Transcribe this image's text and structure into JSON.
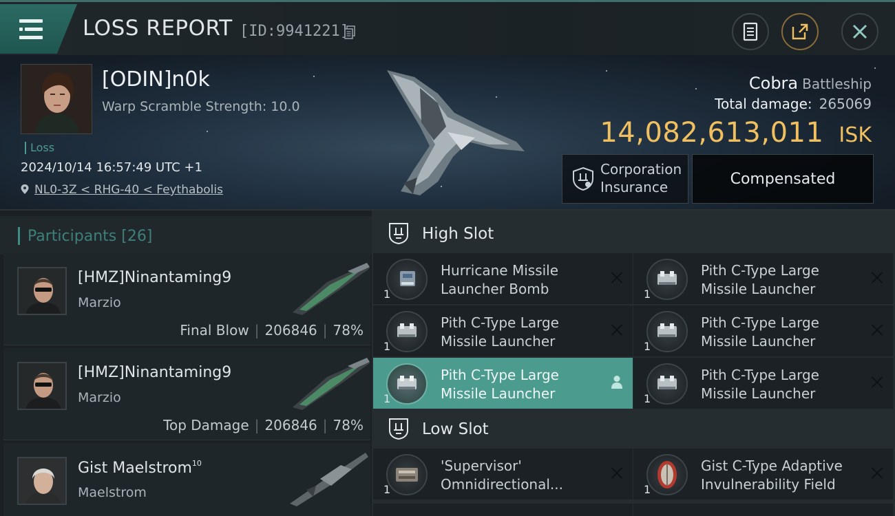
{
  "header": {
    "title": "LOSS REPORT",
    "report_id": "[ID:9941221]"
  },
  "victim": {
    "name": "[ODIN]n0k",
    "warp_scramble": "Warp Scramble Strength: 10.0",
    "loss_tag": "Loss",
    "datetime": "2024/10/14 16:57:49 UTC +1",
    "location": "NL0-3Z < RHG-40 < Feythabolis"
  },
  "ship": {
    "name": "Cobra",
    "class": "Battleship",
    "total_damage_label": "Total damage:",
    "total_damage": "265069",
    "isk_value": "14,082,613,011",
    "isk_unit": "ISK"
  },
  "insurance": {
    "label_line1": "Corporation",
    "label_line2": "Insurance",
    "status": "Compensated"
  },
  "participants": {
    "label": "Participants",
    "count": "[26]",
    "rows": [
      {
        "name": "[HMZ]Ninantaming9",
        "ship": "Marzio",
        "role": "Final Blow",
        "damage": "206846",
        "percent": "78%"
      },
      {
        "name": "[HMZ]Ninantaming9",
        "ship": "Marzio",
        "role": "Top Damage",
        "damage": "206846",
        "percent": "78%"
      },
      {
        "name": "Gist Maelstrom",
        "name_sup": "10",
        "ship": "Maelstrom"
      }
    ]
  },
  "fitting": {
    "high_slot_label": "High Slot",
    "low_slot_label": "Low Slot",
    "high_items": [
      {
        "line1": "Hurricane Missile",
        "line2": "Launcher Bomb",
        "qty": "1"
      },
      {
        "line1": "Pith C-Type Large",
        "line2": "Missile Launcher",
        "qty": "1"
      },
      {
        "line1": "Pith C-Type Large",
        "line2": "Missile Launcher",
        "qty": "1"
      },
      {
        "line1": "Pith C-Type Large",
        "line2": "Missile Launcher",
        "qty": "1"
      },
      {
        "line1": "Pith C-Type Large",
        "line2": "Missile Launcher",
        "qty": "1"
      },
      {
        "line1": "Pith C-Type Large",
        "line2": "Missile Launcher",
        "qty": "1"
      }
    ],
    "low_items": [
      {
        "line1": "'Supervisor'",
        "line2": "Omnidirectional...",
        "qty": "1"
      },
      {
        "line1": "Gist C-Type Adaptive",
        "line2": "Invulnerability Field",
        "qty": "1"
      }
    ]
  },
  "colors": {
    "accent_teal": "#3f8d82",
    "isk_gold": "#f0c060",
    "selected_item": "#4c9b8f"
  }
}
